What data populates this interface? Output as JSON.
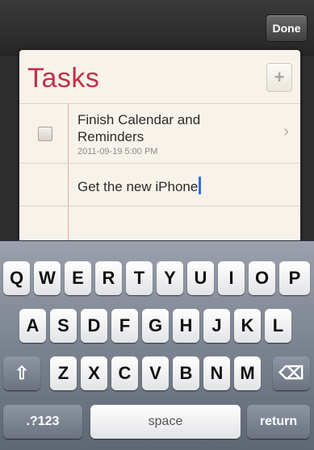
{
  "topbar": {
    "done_label": "Done"
  },
  "list": {
    "title": "Tasks",
    "add_icon": "+",
    "tasks": [
      {
        "title_line1": "Finish Calendar and",
        "title_line2": "Reminders",
        "date": "2011-09-19 5:00 PM",
        "chevron": "›"
      },
      {
        "title": "Get the new iPhone"
      }
    ]
  },
  "keyboard": {
    "row1": [
      "Q",
      "W",
      "E",
      "R",
      "T",
      "Y",
      "U",
      "I",
      "O",
      "P"
    ],
    "row2": [
      "A",
      "S",
      "D",
      "F",
      "G",
      "H",
      "J",
      "K",
      "L"
    ],
    "row3": [
      "Z",
      "X",
      "C",
      "V",
      "B",
      "N",
      "M"
    ],
    "shift_icon": "⇧",
    "delete_icon": "⌫",
    "numbers_label": ".?123",
    "space_label": "space",
    "return_label": "return"
  }
}
